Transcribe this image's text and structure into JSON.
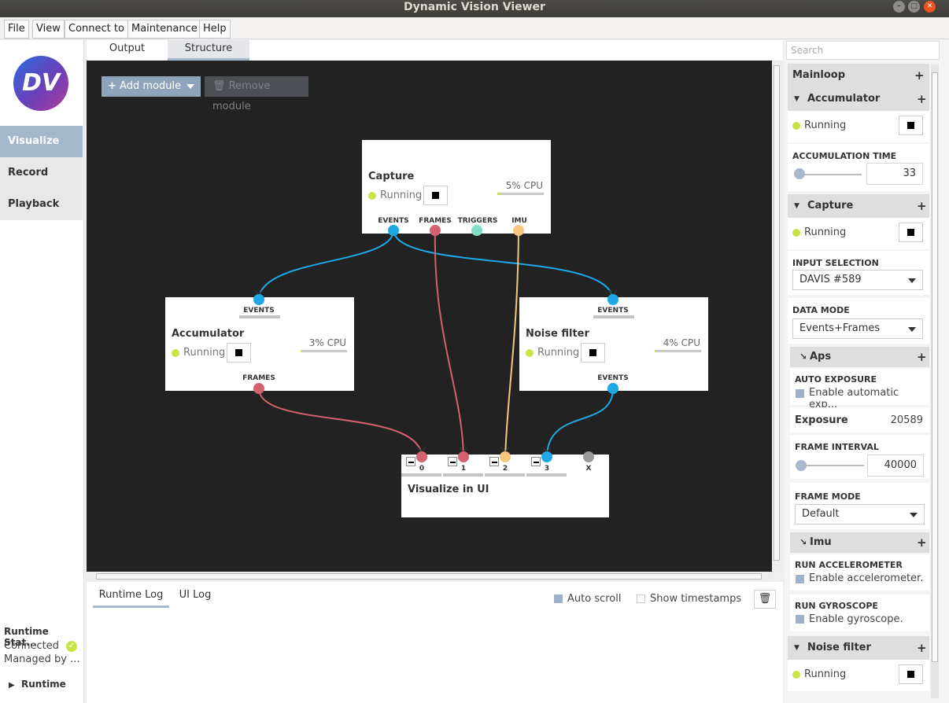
{
  "window": {
    "title": "Dynamic Vision Viewer"
  },
  "menu": [
    "File",
    "View",
    "Connect to",
    "Maintenance",
    "Help"
  ],
  "sidebar": {
    "logo_text": "DV",
    "items": [
      {
        "label": "Visualize"
      },
      {
        "label": "Record"
      },
      {
        "label": "Playback"
      }
    ],
    "runtime_status": {
      "title": "Runtime Stat...",
      "state": "Connected",
      "managed": "Managed by ...",
      "runtime_label": "Runtime"
    }
  },
  "main_tabs": [
    "Output",
    "Structure"
  ],
  "toolbar": {
    "add_module": "Add module",
    "remove_module": "Remove module"
  },
  "nodes": {
    "capture": {
      "title": "Capture",
      "status": "Running",
      "cpu": "5% CPU",
      "cpu_pct": 5,
      "outputs": [
        "EVENTS",
        "FRAMES",
        "TRIGGERS",
        "IMU"
      ]
    },
    "accumulator": {
      "title": "Accumulator",
      "status": "Running",
      "cpu": "3% CPU",
      "cpu_pct": 3,
      "input": "EVENTS",
      "output": "FRAMES"
    },
    "noise_filter": {
      "title": "Noise filter",
      "status": "Running",
      "cpu": "4% CPU",
      "cpu_pct": 4,
      "input": "EVENTS",
      "output": "EVENTS"
    },
    "visualize": {
      "title": "Visualize in UI",
      "inputs": [
        "0",
        "1",
        "2",
        "3",
        "X"
      ]
    }
  },
  "port_colors": {
    "events": "#1ea8e6",
    "frames": "#d4616f",
    "triggers": "#7fe0c5",
    "imu": "#f7c77f",
    "unused": "#9a9a9a"
  },
  "log": {
    "tabs": [
      "Runtime Log",
      "UI Log"
    ],
    "auto_scroll": "Auto scroll",
    "auto_scroll_checked": true,
    "show_timestamps": "Show timestamps",
    "show_timestamps_checked": false
  },
  "right_panel": {
    "search_placeholder": "Search",
    "mainloop": "Mainloop",
    "accumulator": {
      "title": "Accumulator",
      "status": "Running",
      "accumulation_time_label": "ACCUMULATION TIME",
      "accumulation_time": "33"
    },
    "capture": {
      "title": "Capture",
      "status": "Running",
      "input_selection_label": "INPUT SELECTION",
      "input_selection": "DAVIS #589",
      "data_mode_label": "DATA MODE",
      "data_mode": "Events+Frames",
      "aps": {
        "title": "Aps",
        "auto_exposure_label": "AUTO EXPOSURE",
        "auto_exposure_text": "Enable automatic exp...",
        "exposure_label": "Exposure",
        "exposure": "20589",
        "frame_interval_label": "FRAME INTERVAL",
        "frame_interval": "40000",
        "frame_mode_label": "FRAME MODE",
        "frame_mode": "Default"
      },
      "imu": {
        "title": "Imu",
        "run_accel_label": "RUN ACCELEROMETER",
        "run_accel_text": "Enable accelerometer.",
        "run_gyro_label": "RUN GYROSCOPE",
        "run_gyro_text": "Enable gyroscope."
      }
    },
    "noise_filter": {
      "title": "Noise filter",
      "status": "Running"
    }
  }
}
